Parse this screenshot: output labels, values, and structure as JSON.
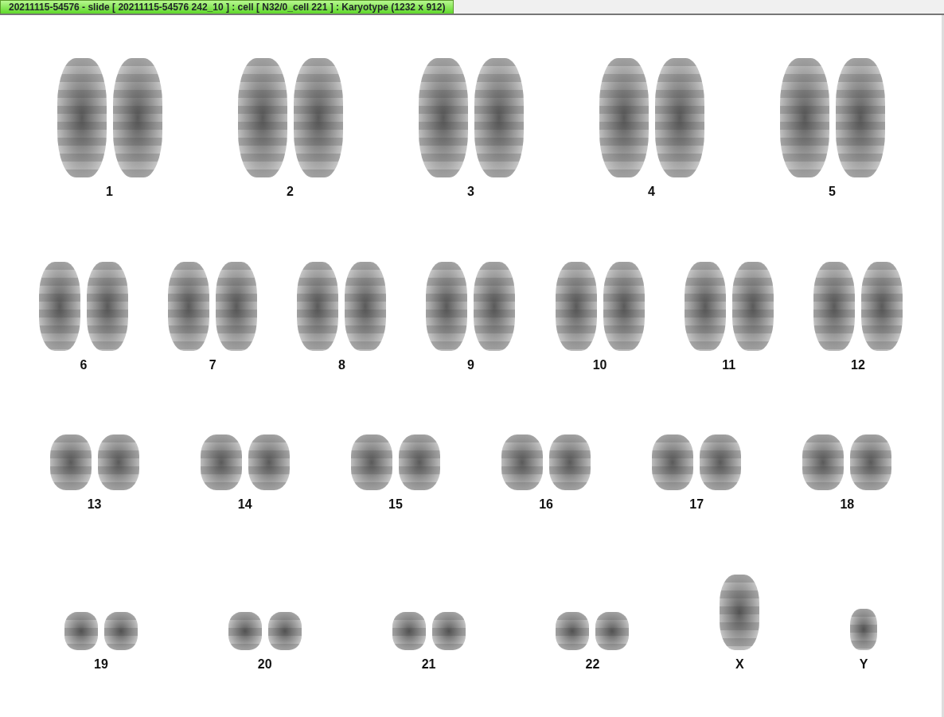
{
  "tab": {
    "title": "20211115-54576 - slide [ 20211115-54576 242_10 ] : cell [ N32/0_cell 221 ] : Karyotype  (1232 x 912)",
    "selected": true
  },
  "karyogram": {
    "rows": [
      {
        "items": [
          {
            "label": "1",
            "kind": "pair"
          },
          {
            "label": "2",
            "kind": "pair"
          },
          {
            "label": "3",
            "kind": "pair"
          },
          {
            "label": "4",
            "kind": "pair"
          },
          {
            "label": "5",
            "kind": "pair"
          }
        ]
      },
      {
        "items": [
          {
            "label": "6",
            "kind": "pair"
          },
          {
            "label": "7",
            "kind": "pair"
          },
          {
            "label": "8",
            "kind": "pair"
          },
          {
            "label": "9",
            "kind": "pair"
          },
          {
            "label": "10",
            "kind": "pair"
          },
          {
            "label": "11",
            "kind": "pair"
          },
          {
            "label": "12",
            "kind": "pair"
          }
        ]
      },
      {
        "items": [
          {
            "label": "13",
            "kind": "pair"
          },
          {
            "label": "14",
            "kind": "pair"
          },
          {
            "label": "15",
            "kind": "pair"
          },
          {
            "label": "16",
            "kind": "pair"
          },
          {
            "label": "17",
            "kind": "pair"
          },
          {
            "label": "18",
            "kind": "pair"
          }
        ]
      },
      {
        "items": [
          {
            "label": "19",
            "kind": "pair"
          },
          {
            "label": "20",
            "kind": "pair"
          },
          {
            "label": "21",
            "kind": "pair"
          },
          {
            "label": "22",
            "kind": "pair"
          },
          {
            "label": "X",
            "kind": "single"
          },
          {
            "label": "Y",
            "kind": "single"
          }
        ]
      }
    ]
  }
}
